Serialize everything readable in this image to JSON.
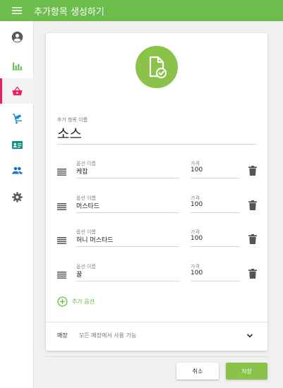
{
  "header": {
    "title": "추가항목 생성하기"
  },
  "sidebar": {
    "items": [
      {
        "icon": "account-circle-icon"
      },
      {
        "icon": "bar-chart-icon"
      },
      {
        "icon": "basket-icon",
        "active": true
      },
      {
        "icon": "dolly-icon"
      },
      {
        "icon": "contact-card-icon"
      },
      {
        "icon": "people-icon"
      },
      {
        "icon": "gear-icon"
      }
    ]
  },
  "form": {
    "name_label": "추가 항목 이름",
    "name_value": "소스",
    "options": [
      {
        "name_label": "옵션 이름",
        "name": "케찹",
        "price_label": "가격",
        "price": "100"
      },
      {
        "name_label": "옵션 이름",
        "name": "머스타드",
        "price_label": "가격",
        "price": "100"
      },
      {
        "name_label": "옵션 이름",
        "name": "허니 머스타드",
        "price_label": "가격",
        "price": "100"
      },
      {
        "name_label": "옵션 이름",
        "name": "꿀",
        "price_label": "가격",
        "price": "100"
      }
    ],
    "add_option_label": "추가 옵션",
    "store_label": "매장",
    "store_value": "모든 매장에서 사용 가능"
  },
  "actions": {
    "cancel_label": "취소",
    "save_label": "저장"
  },
  "colors": {
    "brand": "#6cbd4b",
    "accent_light": "#8bc34a",
    "active_marker": "#e91e63",
    "icon_gray": "#5a5a5a"
  }
}
